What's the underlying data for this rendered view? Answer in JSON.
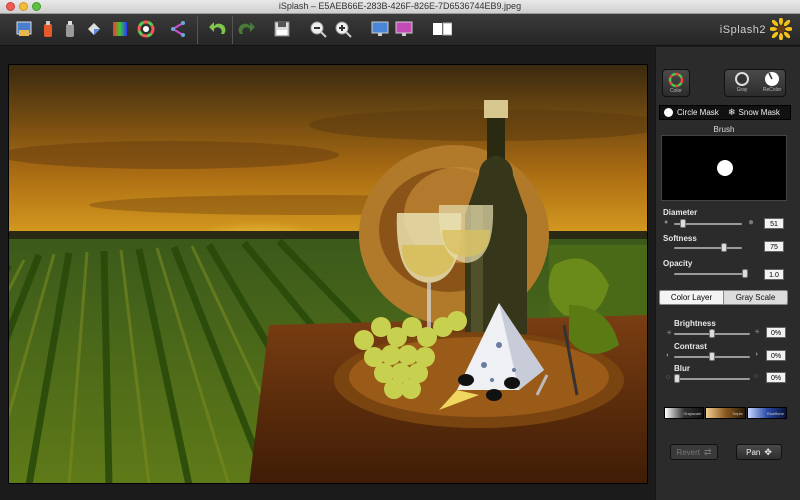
{
  "window": {
    "title": "iSplash – E5AEB66E-283B-426F-826E-7D6536744EB9.jpeg"
  },
  "toolbar": {
    "brand": "iSplash2",
    "tools": [
      {
        "name": "open-image-icon"
      },
      {
        "name": "color-bucket-icon"
      },
      {
        "name": "gray-bucket-icon"
      },
      {
        "name": "paint-fill-icon"
      },
      {
        "name": "color-grid-icon"
      },
      {
        "name": "color-wheel-icon"
      },
      {
        "name": "share-icon"
      },
      {
        "name": "undo-icon"
      },
      {
        "name": "redo-icon"
      },
      {
        "name": "save-icon"
      },
      {
        "name": "zoom-out-icon"
      },
      {
        "name": "zoom-in-icon"
      },
      {
        "name": "monitor-icon"
      },
      {
        "name": "monitor-color-icon"
      },
      {
        "name": "compare-icon"
      }
    ]
  },
  "panel": {
    "modes": {
      "color": "Color",
      "gray": "Gray",
      "recolor": "ReColor"
    },
    "mask": {
      "circle": "Circle Mask",
      "snow": "Snow Mask"
    },
    "brush_title": "Brush",
    "diameter": {
      "label": "Diameter",
      "value": "51",
      "level": 0.1
    },
    "softness": {
      "label": "Softness",
      "value": "75",
      "level": 0.75
    },
    "opacity": {
      "label": "Opacity",
      "value": "1.0",
      "level": 1.0
    },
    "layers": {
      "color": "Color Layer",
      "gray": "Gray Scale"
    },
    "brightness": {
      "label": "Brightness",
      "value": "0%",
      "level": 0.5
    },
    "contrast": {
      "label": "Contrast",
      "value": "0%",
      "level": 0.5
    },
    "blur": {
      "label": "Blur",
      "value": "0%",
      "level": 0.0
    },
    "presets": [
      "Grayscale",
      "Sepia",
      "Blueftone"
    ],
    "revert": "Revert",
    "pan": "Pan"
  },
  "colors": {
    "accent_active": "#f4f4f4",
    "panel_bg": "#2b2b2b",
    "toolbar_bg": "#2f2f2f"
  }
}
